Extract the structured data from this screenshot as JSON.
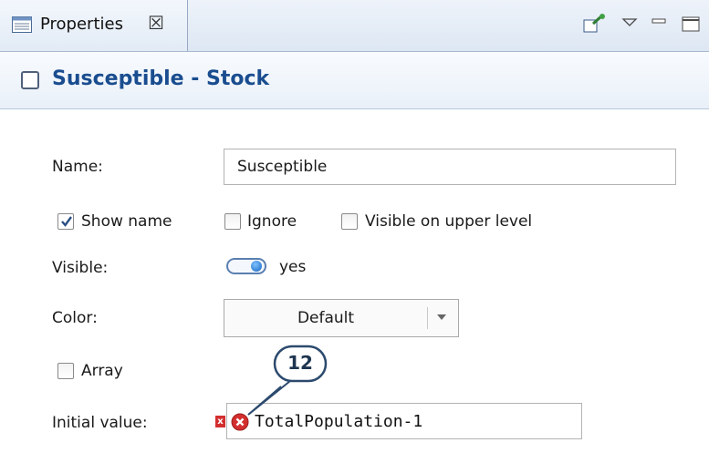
{
  "tab": {
    "label": "Properties",
    "close_glyph": "☒",
    "icon": "properties-list-icon"
  },
  "toolbar": {
    "icons": [
      "pin-icon",
      "view-menu-icon",
      "minimize-icon",
      "maximize-icon"
    ]
  },
  "header": {
    "title": "Susceptible - Stock",
    "icon": "stock-square-icon"
  },
  "form": {
    "name_label": "Name:",
    "name_value": "Susceptible",
    "show_name": {
      "label": "Show name",
      "checked": true
    },
    "ignore": {
      "label": "Ignore",
      "checked": false
    },
    "visible_upper": {
      "label": "Visible on upper level",
      "checked": false
    },
    "visible_label": "Visible:",
    "visible_value": "yes",
    "color_label": "Color:",
    "color_value": "Default",
    "array": {
      "label": "Array",
      "checked": false
    },
    "initial_label": "Initial value:",
    "initial_value": "TotalPopulation-1",
    "error_marker": "x"
  },
  "callout": {
    "number": "12"
  },
  "colors": {
    "accent": "#1a4d8f",
    "error": "#d32f2f",
    "toggle": "#1565c0"
  }
}
